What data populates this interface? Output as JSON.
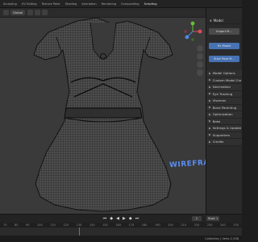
{
  "workspace_tabs": [
    "Sculpting",
    "UV Editing",
    "Texture Paint",
    "Shading",
    "Animation",
    "Rendering",
    "Compositing",
    "Scripting"
  ],
  "workspace_active_index": 7,
  "viewport": {
    "orientation_label": "Global",
    "overlay_text": "WIREFRAME"
  },
  "sidebar": {
    "panel_title": "Model",
    "buttons": {
      "import": "Import M...",
      "fix_model": "Fix Model",
      "start_pose": "Start Pose M..."
    },
    "items": [
      "Model Options",
      "Custom Model Cre",
      "Decimation",
      "Eye Tracking",
      "Visemes",
      "Bone Parenting",
      "Optimization",
      "Bake",
      "Settings & Update",
      "Supporters",
      "Credits"
    ]
  },
  "timeline": {
    "current_frame": "1",
    "start_label": "Start",
    "start_value": "1",
    "ruler": [
      "70",
      "80",
      "90",
      "100",
      "110",
      "120",
      "130",
      "140",
      "150",
      "160",
      "170",
      "180",
      "190",
      "200",
      "210",
      "220",
      "230",
      "240",
      "250"
    ]
  },
  "status": {
    "text": "Collection | Verts 2,338"
  },
  "colors": {
    "accent_blue": "#4772b3",
    "wireframe_label": "#5a8df0",
    "viewport_bg": "#3a3a3a",
    "panel_bg": "#2a2a2a"
  }
}
